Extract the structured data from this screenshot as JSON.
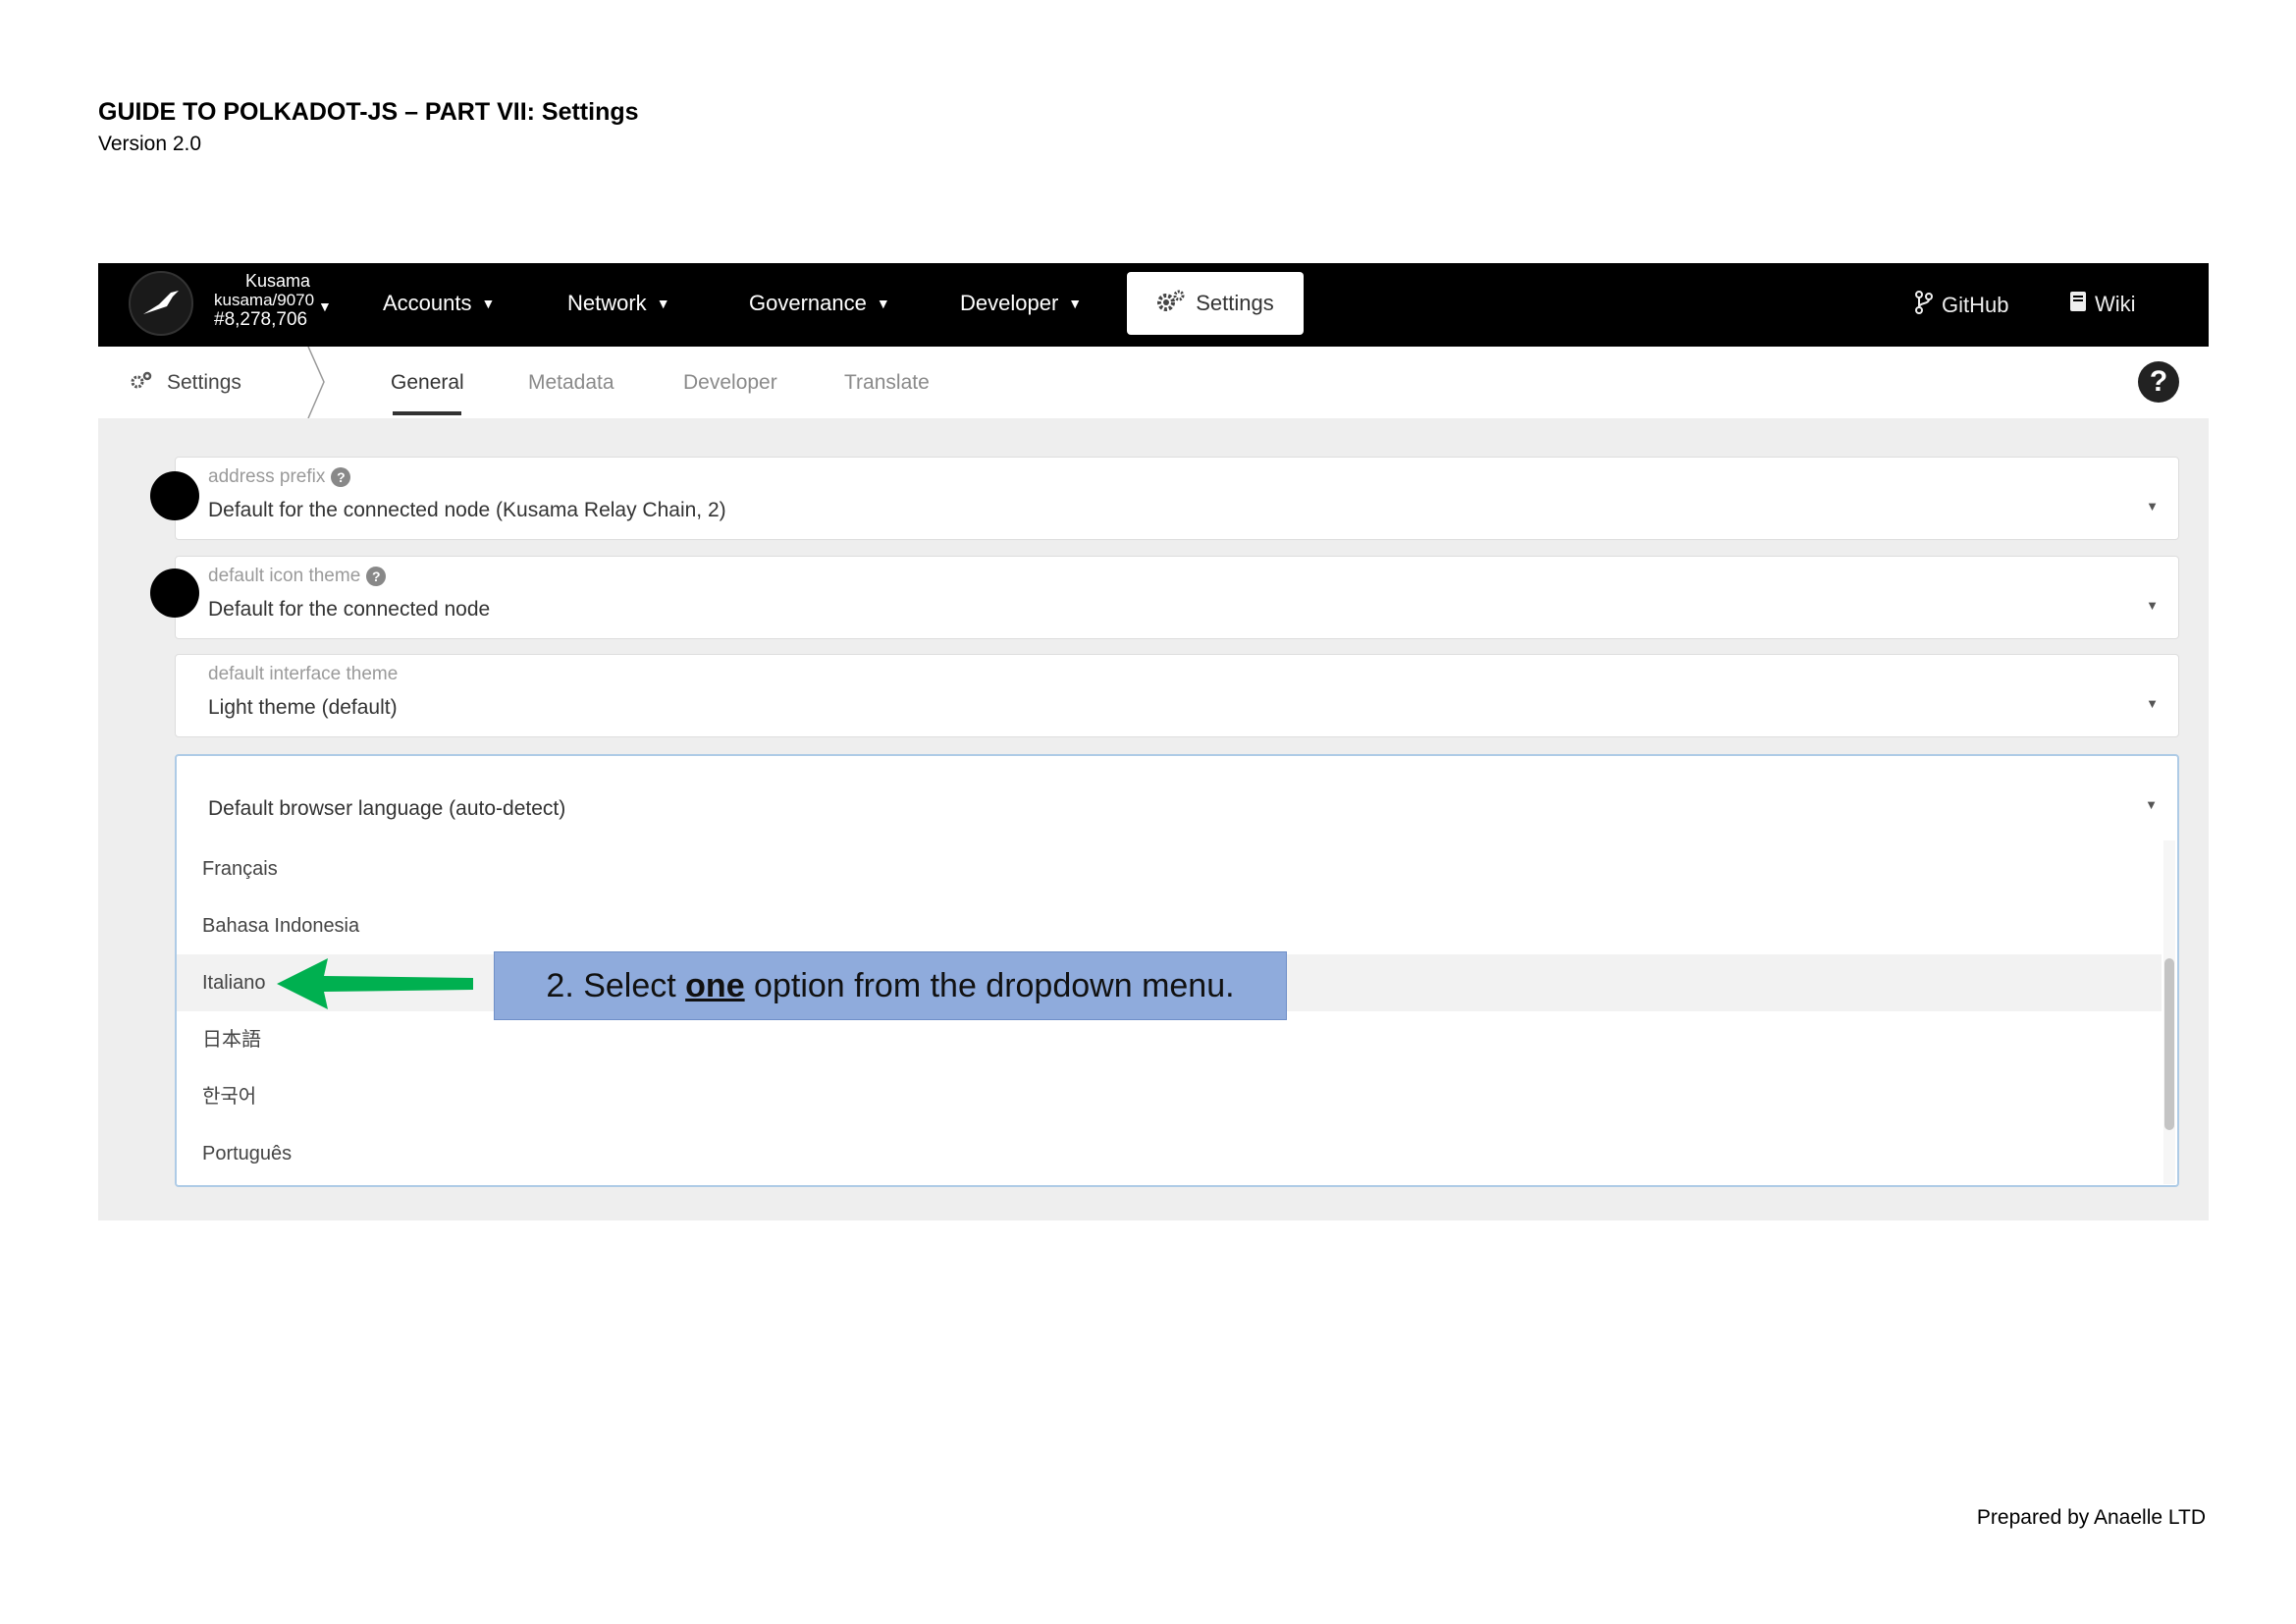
{
  "document": {
    "title": "GUIDE TO POLKADOT-JS – PART VII: Settings",
    "version": "Version 2.0",
    "footer": "Prepared by Anaelle LTD"
  },
  "topbar": {
    "chain_name": "Kusama",
    "chain_version": "kusama/9070",
    "block_number": "#8,278,706",
    "nav": [
      {
        "label": "Accounts"
      },
      {
        "label": "Network"
      },
      {
        "label": "Governance"
      },
      {
        "label": "Developer"
      }
    ],
    "settings_label": "Settings",
    "github_label": "GitHub",
    "wiki_label": "Wiki"
  },
  "subnav": {
    "section_label": "Settings",
    "tabs": [
      {
        "label": "General",
        "active": true
      },
      {
        "label": "Metadata",
        "active": false
      },
      {
        "label": "Developer",
        "active": false
      },
      {
        "label": "Translate",
        "active": false
      }
    ],
    "help_glyph": "?"
  },
  "fields": {
    "address_prefix": {
      "label": "address prefix",
      "value": "Default for the connected node (Kusama Relay Chain, 2)"
    },
    "icon_theme": {
      "label": "default icon theme",
      "value": "Default for the connected node"
    },
    "interface_theme": {
      "label": "default interface theme",
      "value": "Light theme (default)"
    },
    "language": {
      "value": "Default browser language (auto-detect)",
      "options": [
        "Français",
        "Bahasa Indonesia",
        "Italiano",
        "日本語",
        "한국어",
        "Português"
      ],
      "highlighted_index": 2
    }
  },
  "callout": {
    "prefix": "2. Select ",
    "emphasis": "one",
    "suffix": " option from the dropdown menu."
  },
  "colors": {
    "topbar": "#000000",
    "callout": "#8fabdc",
    "arrow": "#00b050",
    "dropdown_border": "#aecbe6"
  },
  "icons": {
    "logo": "bird-logo-icon",
    "settings": "gears-icon",
    "github": "git-branch-icon",
    "wiki": "book-icon",
    "help": "question-circle-icon",
    "caret": "caret-down-icon",
    "arrow": "left-arrow-icon"
  }
}
